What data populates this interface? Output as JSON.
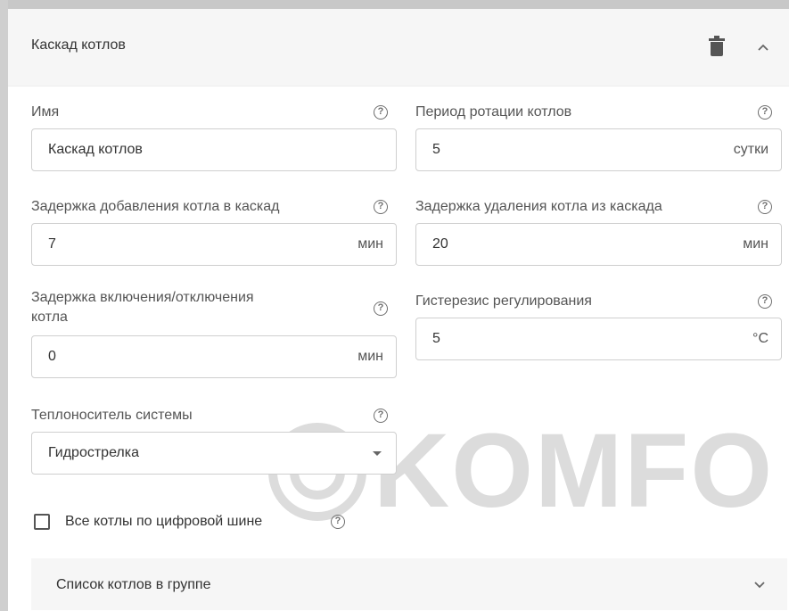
{
  "header": {
    "title": "Каскад котлов",
    "delete_icon": "trash-icon",
    "collapse_icon": "chevron-up-icon"
  },
  "fields": {
    "name": {
      "label": "Имя",
      "value": "Каскад котлов"
    },
    "rotation_period": {
      "label": "Период ротации котлов",
      "value": "5",
      "unit": "сутки"
    },
    "add_delay": {
      "label": "Задержка добавления котла в каскад",
      "value": "7",
      "unit": "мин"
    },
    "remove_delay": {
      "label": "Задержка удаления котла из каскада",
      "value": "20",
      "unit": "мин"
    },
    "switch_delay": {
      "label_line1": "Задержка включения/отключения",
      "label_line2": "котла",
      "value": "0",
      "unit": "мин"
    },
    "hysteresis": {
      "label": "Гистерезис регулирования",
      "value": "5",
      "unit": "°C"
    },
    "coolant": {
      "label": "Теплоноситель системы",
      "value": "Гидрострелка"
    }
  },
  "digital_bus": {
    "label": "Все котлы по цифровой шине",
    "checked": false
  },
  "boiler_list": {
    "label": "Список котлов в группе",
    "icon": "chevron-down-icon"
  },
  "help_glyph": "?",
  "watermark": {
    "text": "KOMFO"
  },
  "colors": {
    "header_bg": "#f6f6f6",
    "border": "#cfcfcf",
    "watermark": "#dcdcdc"
  }
}
